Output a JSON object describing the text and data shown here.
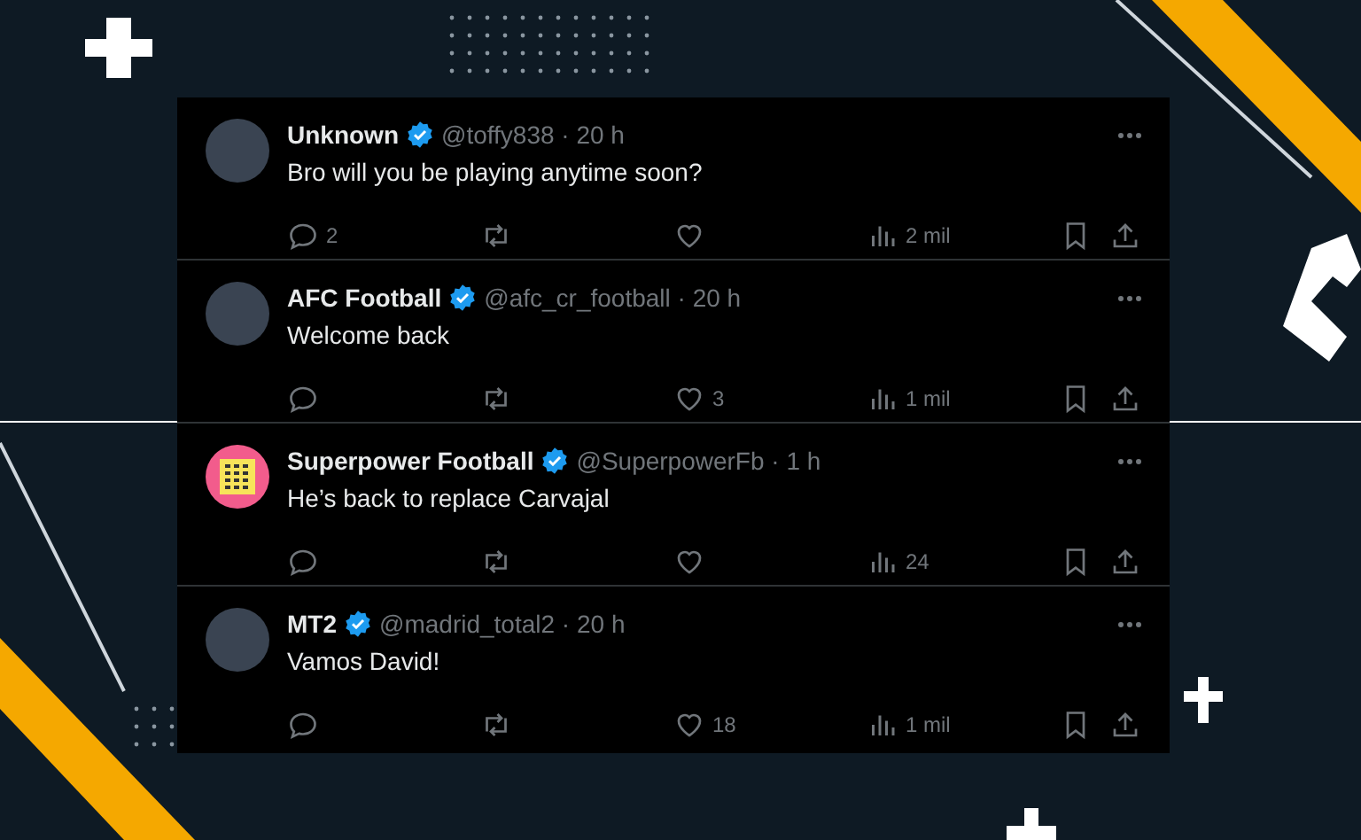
{
  "tweets": [
    {
      "kind": "photo",
      "name": "Unknown",
      "verified": true,
      "meta": "@toffy838 · 20 h",
      "text": "Bro will you be playing anytime soon?",
      "replies": "2",
      "views": "2 mil"
    },
    {
      "kind": "photo",
      "name": "AFC Football",
      "verified": true,
      "meta": "@afc_cr_football · 20 h",
      "text": "Welcome back",
      "likes": "3",
      "views": "1 mil"
    },
    {
      "kind": "logo",
      "name": "Superpower Football",
      "verified": true,
      "meta": "@SuperpowerFb · 1 h",
      "text": "He’s back to replace Carvajal",
      "views": "24"
    },
    {
      "kind": "photo",
      "name": "MT2",
      "verified": true,
      "meta": "@madrid_total2 · 20 h",
      "text": "Vamos David!",
      "likes": "18",
      "views": "1 mil"
    }
  ]
}
